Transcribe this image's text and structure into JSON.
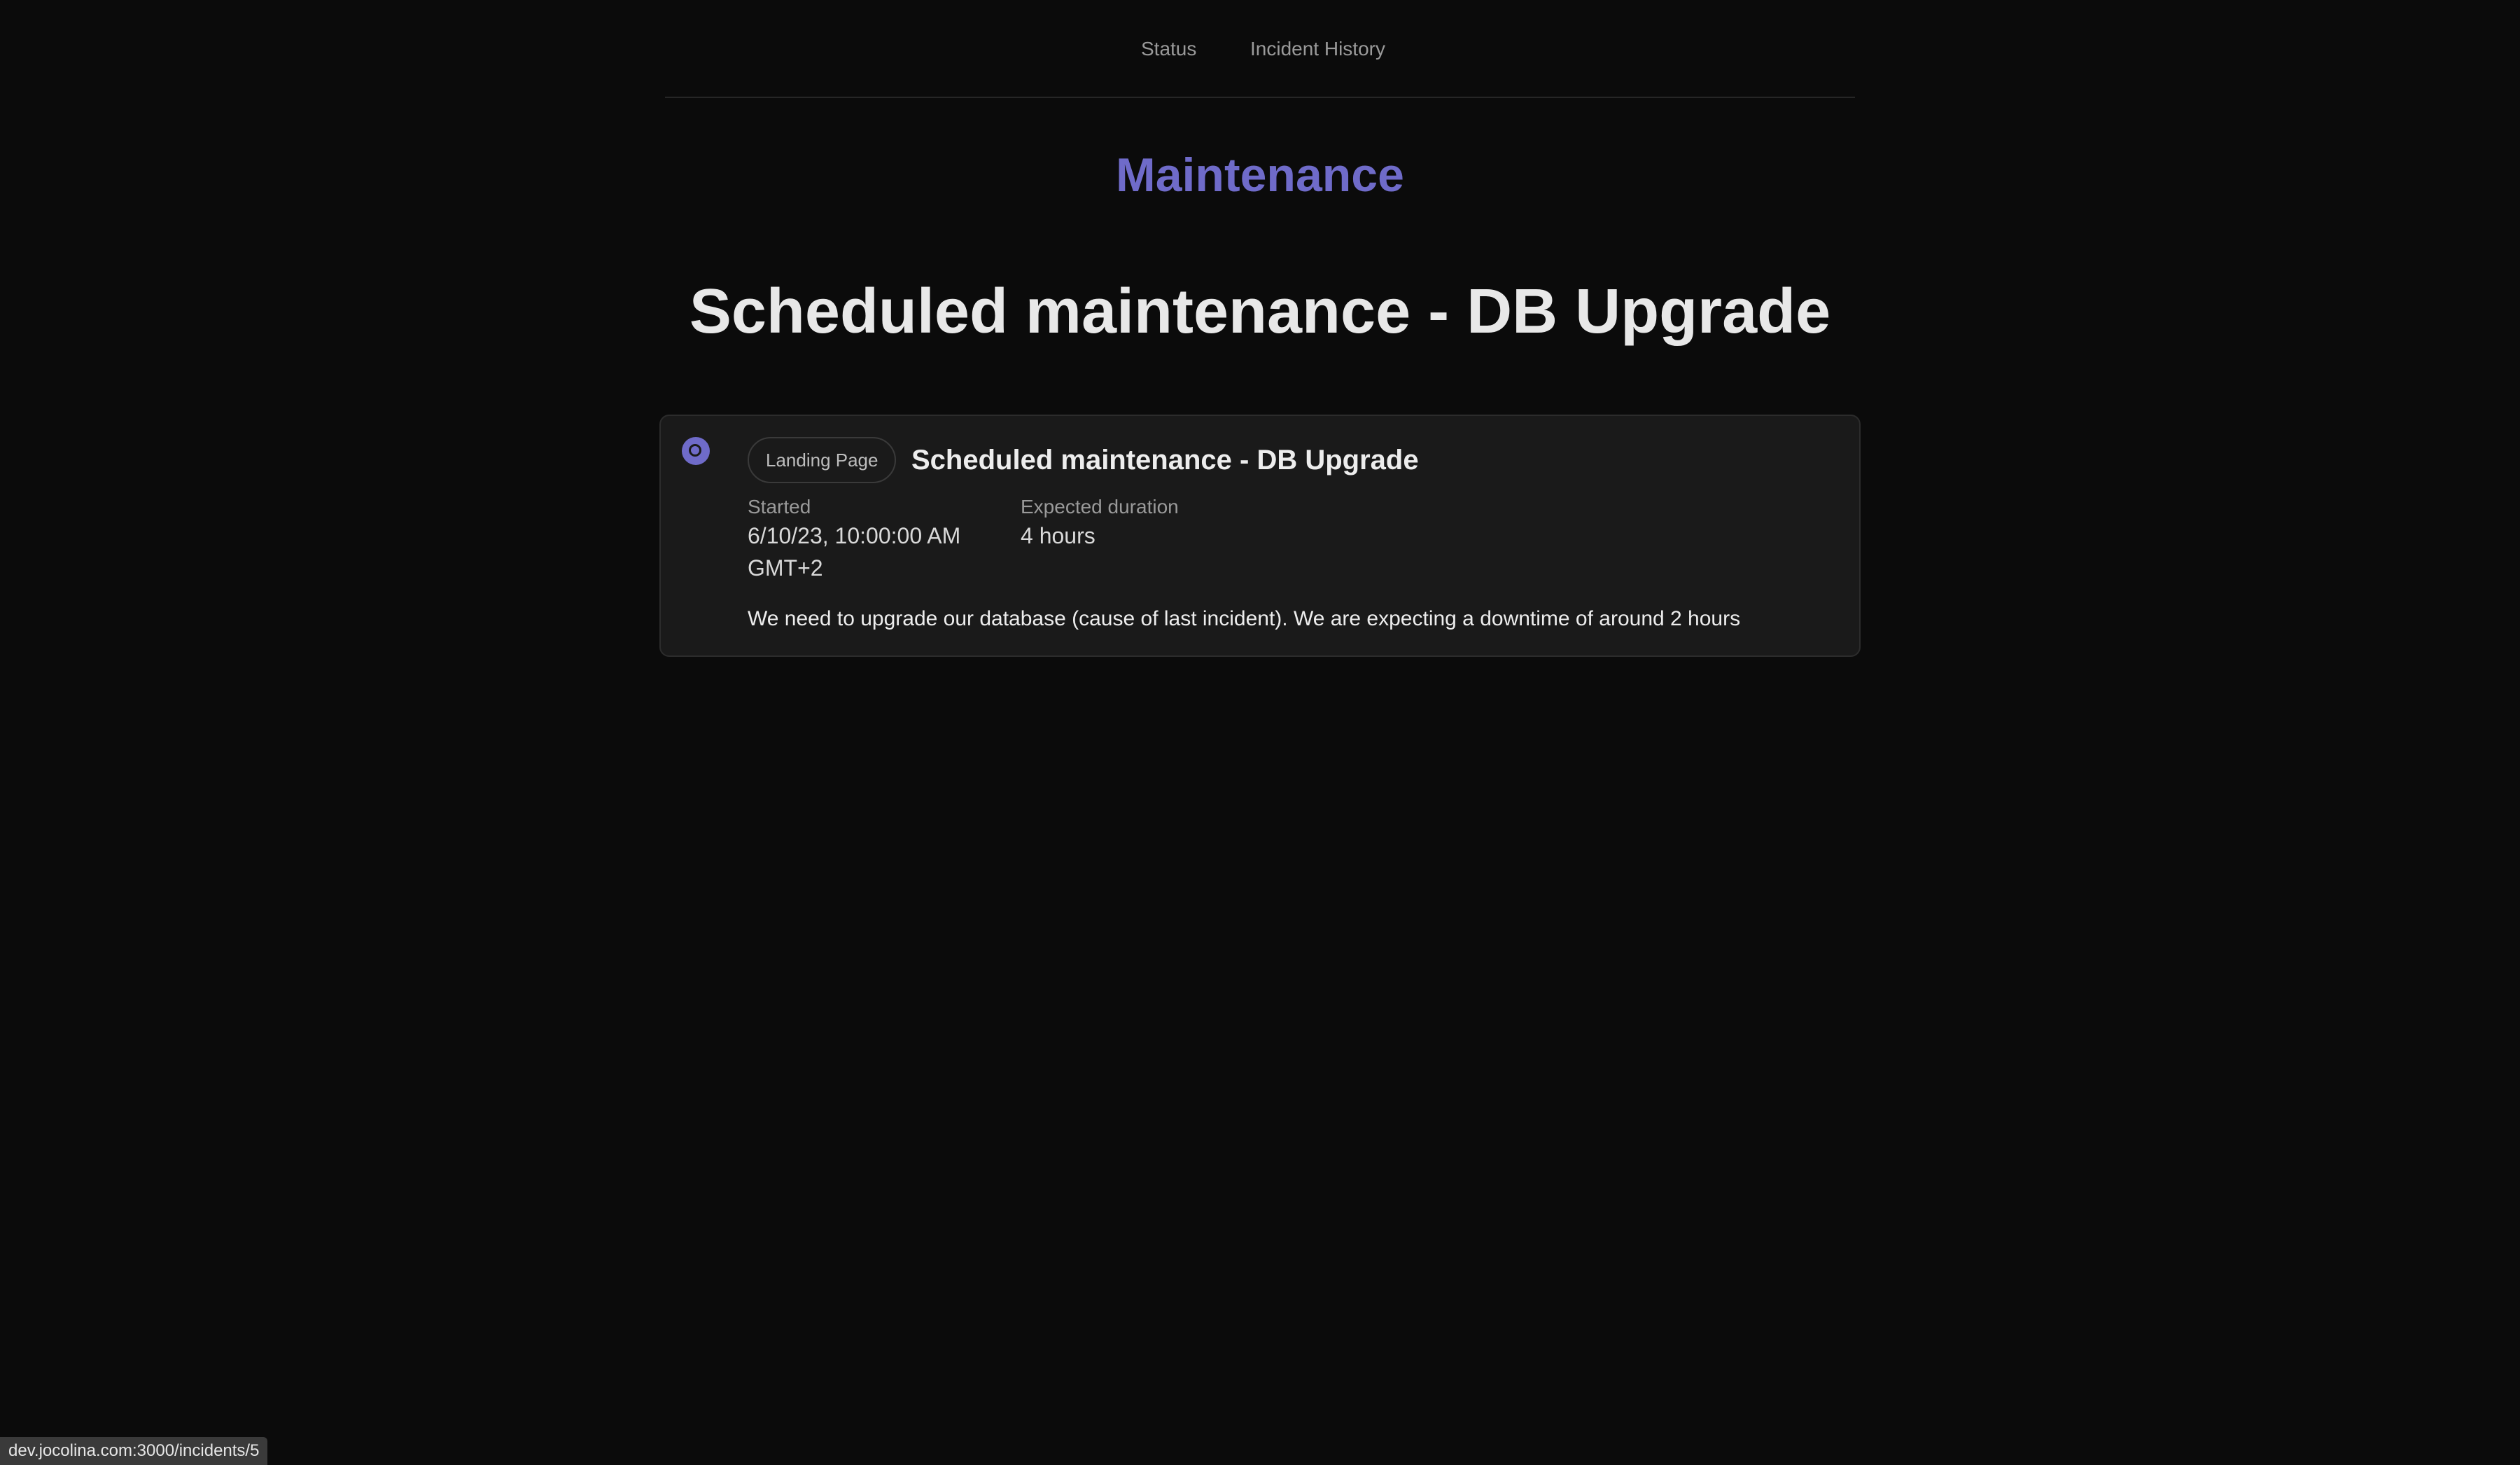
{
  "nav": {
    "status_label": "Status",
    "history_label": "Incident History"
  },
  "header": {
    "status_kind": "Maintenance",
    "title": "Scheduled maintenance - DB Upgrade"
  },
  "incident": {
    "component": "Landing Page",
    "title": "Scheduled maintenance - DB Upgrade",
    "started_label": "Started",
    "started_value": "6/10/23, 10:00:00 AM GMT+2",
    "duration_label": "Expected duration",
    "duration_value": "4 hours",
    "description": "We need to upgrade our database (cause of last incident). We are expecting a downtime of around 2 hours",
    "status_icon": "maintenance-status-icon"
  },
  "statusbar": {
    "url": "dev.jocolina.com:3000/incidents/5"
  },
  "colors": {
    "accent": "#6f6bc9",
    "background": "#0b0b0b",
    "card": "#1a1a1a"
  }
}
